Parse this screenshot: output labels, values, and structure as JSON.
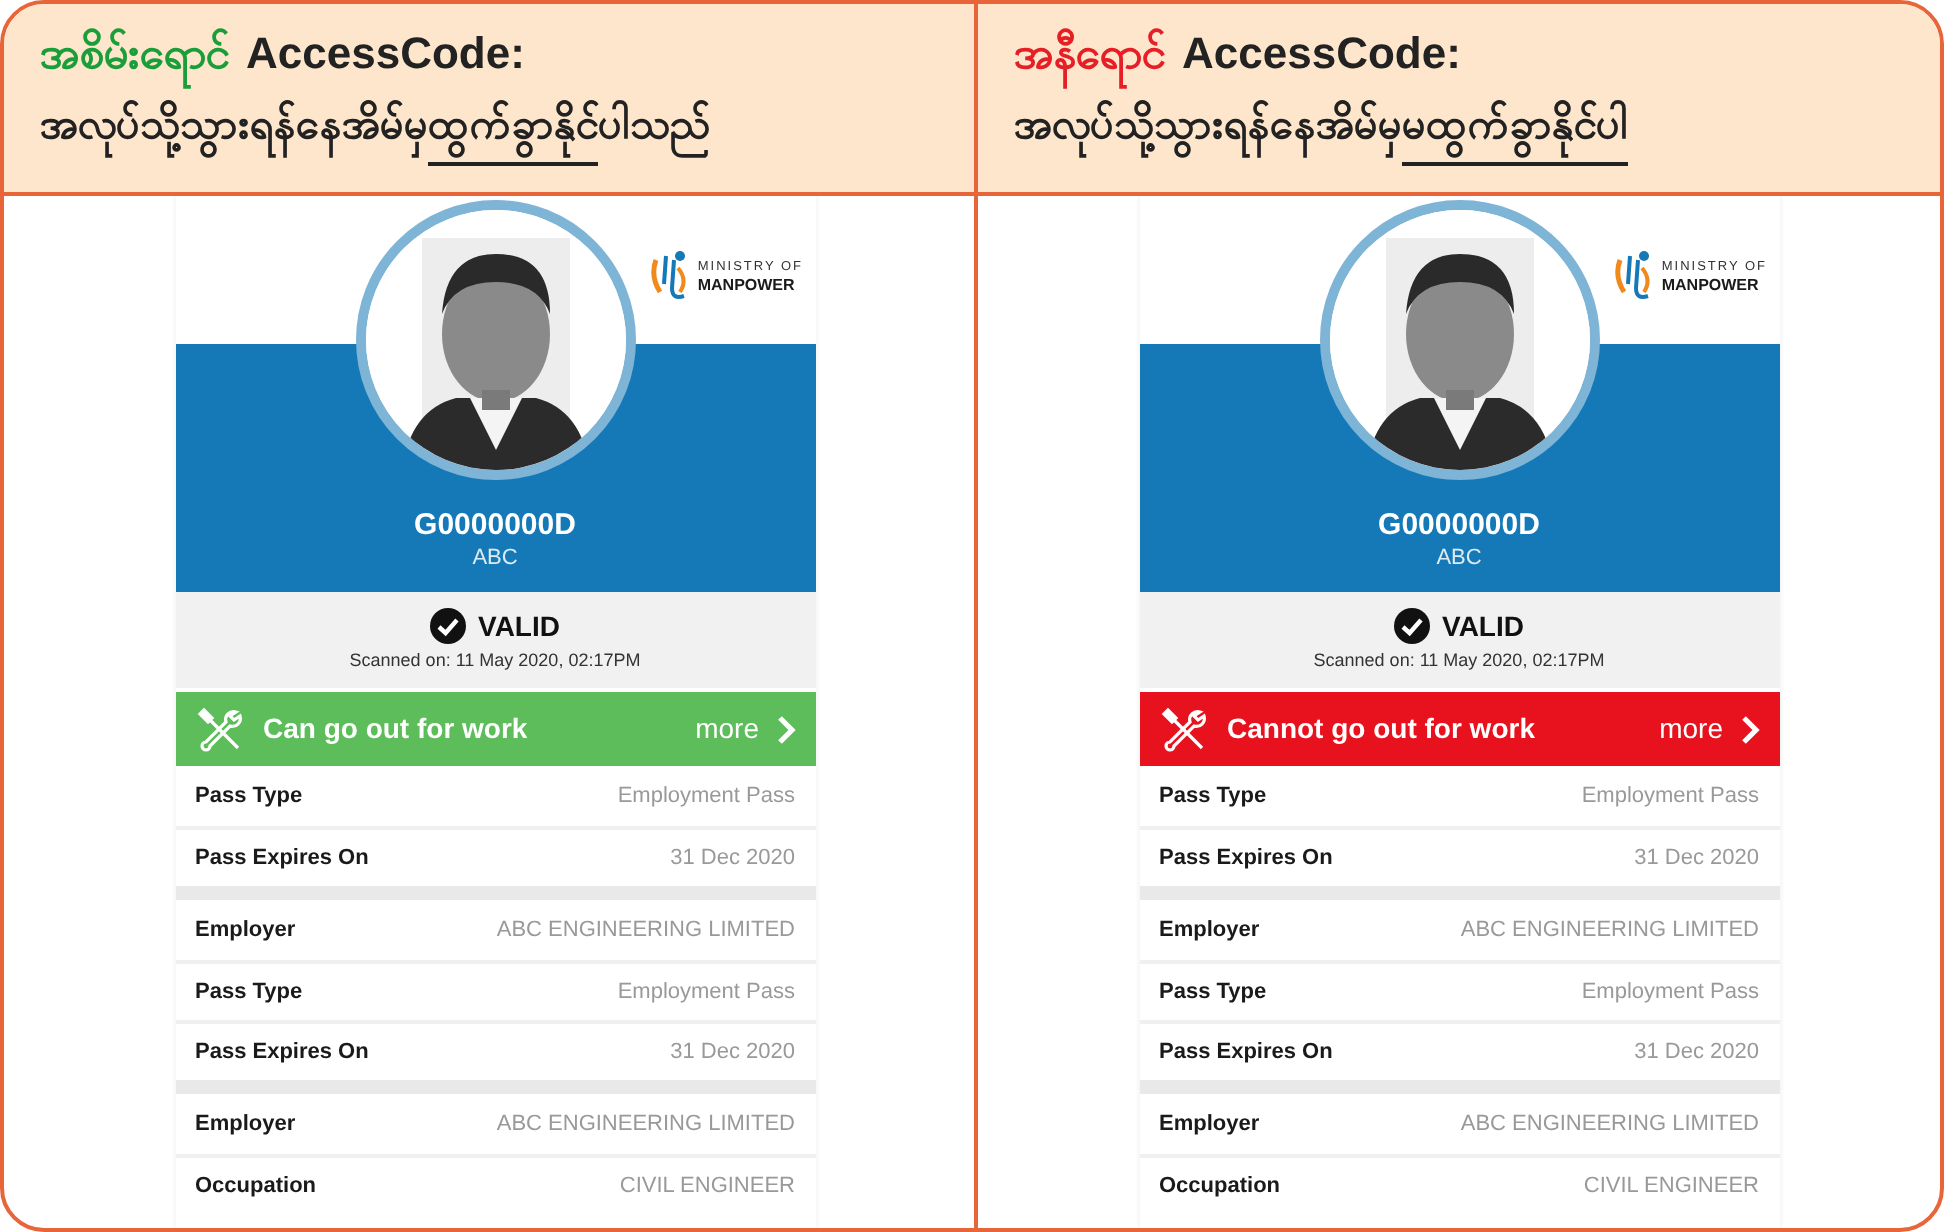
{
  "panels": [
    {
      "heading": {
        "status_word": "အစိမ်းရောင်",
        "kind": "allowed",
        "label": "AccessCode:",
        "segments": [
          {
            "text": "အလုပ်သို့သွားရန်နေအိမ်မှ",
            "underlined": false
          },
          {
            "text": "ထွက်ခွာနိုင်",
            "underlined": true
          },
          {
            "text": "ပါသည်",
            "underlined": false
          }
        ]
      },
      "card": {
        "logo": {
          "line_1": "MINISTRY OF",
          "line_2": "MANPOWER"
        },
        "id": "G0000000D",
        "name": "ABC",
        "validity": "VALID",
        "scanned": "Scanned on: 11 May 2020, 02:17PM",
        "banner": {
          "kind": "allowed",
          "label": "Can go out for work",
          "more": "more"
        },
        "rows": [
          {
            "kind": "row",
            "label": "Pass Type",
            "value": "Employment Pass"
          },
          {
            "kind": "row",
            "label": "Pass Expires On",
            "value": "31 Dec 2020"
          },
          {
            "kind": "gap"
          },
          {
            "kind": "row",
            "label": "Employer",
            "value": "ABC ENGINEERING LIMITED"
          },
          {
            "kind": "row",
            "label": "Pass Type",
            "value": "Employment Pass"
          },
          {
            "kind": "row",
            "label": "Pass Expires On",
            "value": "31 Dec 2020"
          },
          {
            "kind": "gap"
          },
          {
            "kind": "row",
            "label": "Employer",
            "value": "ABC ENGINEERING LIMITED"
          },
          {
            "kind": "row",
            "label": "Occupation",
            "value": "CIVIL ENGINEER"
          }
        ]
      }
    },
    {
      "heading": {
        "status_word": "အနီရောင်",
        "kind": "denied",
        "label": "AccessCode:",
        "segments": [
          {
            "text": "အလုပ်သို့သွားရန်နေအိမ်မှ",
            "underlined": false
          },
          {
            "text": "မထွက်ခွာနိုင်ပါ",
            "underlined": true
          }
        ]
      },
      "card": {
        "logo": {
          "line_1": "MINISTRY OF",
          "line_2": "MANPOWER"
        },
        "id": "G0000000D",
        "name": "ABC",
        "validity": "VALID",
        "scanned": "Scanned on: 11 May 2020, 02:17PM",
        "banner": {
          "kind": "denied",
          "label": "Cannot go out for work",
          "more": "more"
        },
        "rows": [
          {
            "kind": "row",
            "label": "Pass Type",
            "value": "Employment Pass"
          },
          {
            "kind": "row",
            "label": "Pass Expires On",
            "value": "31 Dec 2020"
          },
          {
            "kind": "gap"
          },
          {
            "kind": "row",
            "label": "Employer",
            "value": "ABC ENGINEERING LIMITED"
          },
          {
            "kind": "row",
            "label": "Pass Type",
            "value": "Employment Pass"
          },
          {
            "kind": "row",
            "label": "Pass Expires On",
            "value": "31 Dec 2020"
          },
          {
            "kind": "gap"
          },
          {
            "kind": "row",
            "label": "Employer",
            "value": "ABC ENGINEERING LIMITED"
          },
          {
            "kind": "row",
            "label": "Occupation",
            "value": "CIVIL ENGINEER"
          }
        ]
      }
    }
  ]
}
